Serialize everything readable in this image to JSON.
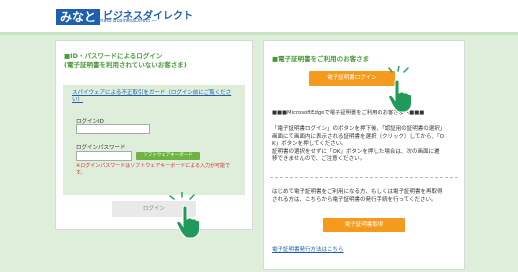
{
  "header": {
    "logo_mark": "みなと",
    "logo_text": "ビジネスダイレクト",
    "logo_en": "― Minato BusinessDirect ―"
  },
  "left_panel": {
    "title_line1": "■ID・パスワードによるログイン",
    "title_line2": "(電子証明書を利用されていないお客さま)",
    "software_kb_link": "スパイウェアによる不正取引をガード（ログイン前にご覧ください）",
    "login_id_label": "ログインID",
    "login_id_value": "",
    "password_label": "ログインパスワード",
    "password_value": "",
    "software_kb_button": "ソフトウェアキーボード",
    "warning": "※ログインパスワードはソフトウェアキーボードによる入力が可能です。",
    "login_button": "ログイン"
  },
  "right_panel": {
    "title": "■電子証明書をご利用のお客さま",
    "cert_login_button": "電子証明書ログイン",
    "edge_heading": "■■■MicrosoftEdgeで電子証明書をご利用のお客さまへ■■■",
    "edge_text": [
      "「電子証明書ログイン」のボタンを押下後、「認証用の証明書の選択」",
      "画面にて画面内に表示される証明書を選択（クリック）してから、「O",
      "K」ボタンを押してください。",
      "証明書の選択をせずに「OK」ボタンを押した場合は、次の画面に遷",
      "移できませんので、ご注意ください。"
    ],
    "first_time_text": [
      "はじめて電子証明書をご利用になる方、もしくは電子証明書を再取得",
      "される方は、こちらから電子証明書の発行手続を行ってください。"
    ],
    "cert_issue_button": "電子証明書取得",
    "issue_howto_link": "電子証明書発行方法はこちら"
  },
  "colors": {
    "accent_green": "#4a9a3a",
    "band_green": "#dfeedb",
    "orange": "#f49a1c",
    "link_blue": "#1f5fb0",
    "warning_red": "#d0342c"
  },
  "icons": [
    "hand-pointer-icon",
    "click-sparkle-icon"
  ]
}
